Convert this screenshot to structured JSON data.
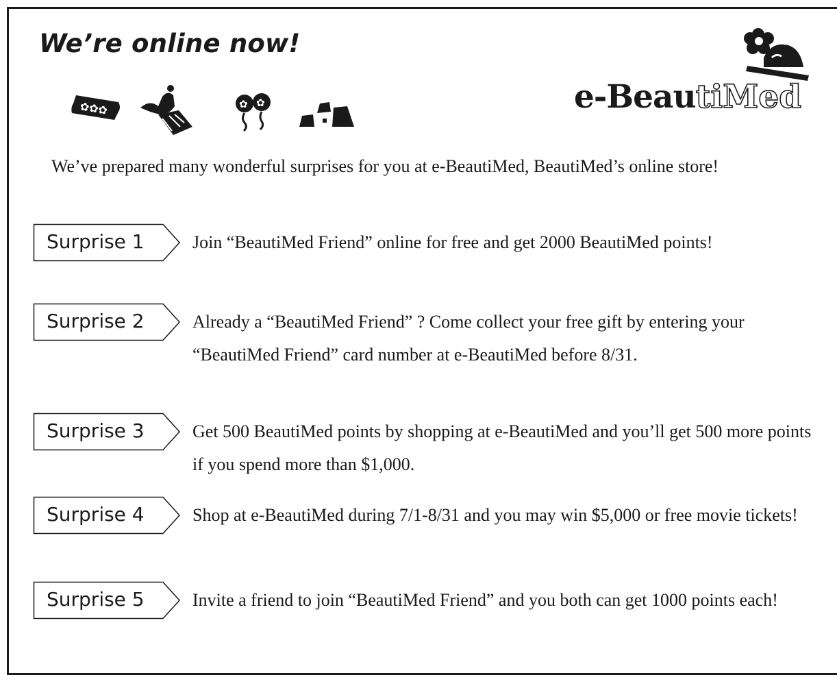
{
  "headline": "We’re online now!",
  "logo": {
    "prefix": "e-Beau",
    "outlined": "tiMed"
  },
  "icons": [
    "ticket-icon",
    "gift-bird-icon",
    "flower-balloons-icon",
    "blocks-icon"
  ],
  "intro": "We’ve prepared many wonderful surprises for you at e-BeautiMed, BeautiMed’s online store!",
  "surprises": [
    {
      "label": "Surprise 1",
      "text": "Join “BeautiMed Friend” online for free and get 2000 BeautiMed points!"
    },
    {
      "label": "Surprise 2",
      "text": "Already a “BeautiMed Friend” ? Come collect your free gift by entering your “BeautiMed Friend” card number at e-BeautiMed before 8/31."
    },
    {
      "label": "Surprise 3",
      "text": "Get 500 BeautiMed points by shopping at e-BeautiMed and you’ll get 500 more points if you spend more than $1,000."
    },
    {
      "label": "Surprise 4",
      "text": "Shop at e-BeautiMed during 7/1-8/31 and you may win $5,000 or free movie tickets!"
    },
    {
      "label": "Surprise 5",
      "text": "Invite a friend to join “BeautiMed Friend” and you both can get 1000 points each!"
    }
  ],
  "colors": {
    "ink": "#1a1a1a",
    "background": "#ffffff"
  }
}
